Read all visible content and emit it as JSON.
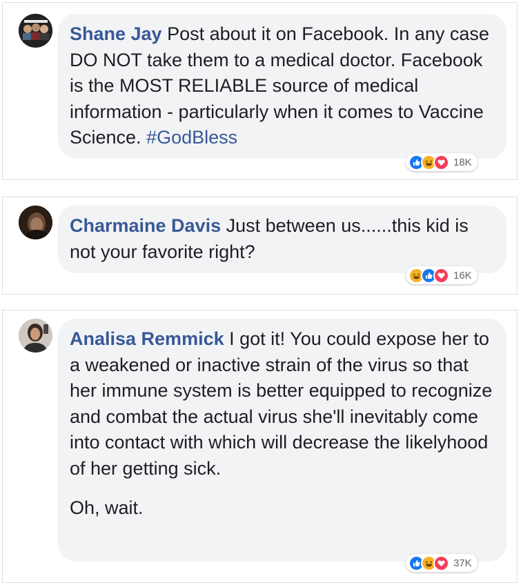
{
  "comments": [
    {
      "author": "Shane Jay",
      "text": "Post about it on Facebook. In any case DO NOT take them to a medical doctor. Facebook is the MOST RELIABLE source of medical information - particularly when it comes to Vaccine Science.",
      "hashtag": "#GodBless",
      "reaction_icons": [
        "like-icon",
        "haha-icon",
        "love-icon"
      ],
      "reaction_count": "18K"
    },
    {
      "author": "Charmaine Davis",
      "text": "Just between us......this kid is not your favorite right?",
      "reaction_icons": [
        "haha-icon",
        "like-icon",
        "love-icon"
      ],
      "reaction_count": "16K"
    },
    {
      "author": "Analisa Remmick",
      "text": "I got it! You could expose her to a weakened or inactive strain of the virus so that her immune system is better equipped to recognize and combat the actual virus she'll inevitably come into contact with which will decrease the likelyhood of her getting sick.",
      "text2": "Oh, wait.",
      "reaction_icons": [
        "like-icon",
        "haha-icon",
        "love-icon"
      ],
      "reaction_count": "37K"
    }
  ],
  "colors": {
    "author": "#385898",
    "bubble": "#f2f3f5",
    "like": "#1877f2",
    "haha": "#f7b125",
    "love": "#f33e58"
  }
}
